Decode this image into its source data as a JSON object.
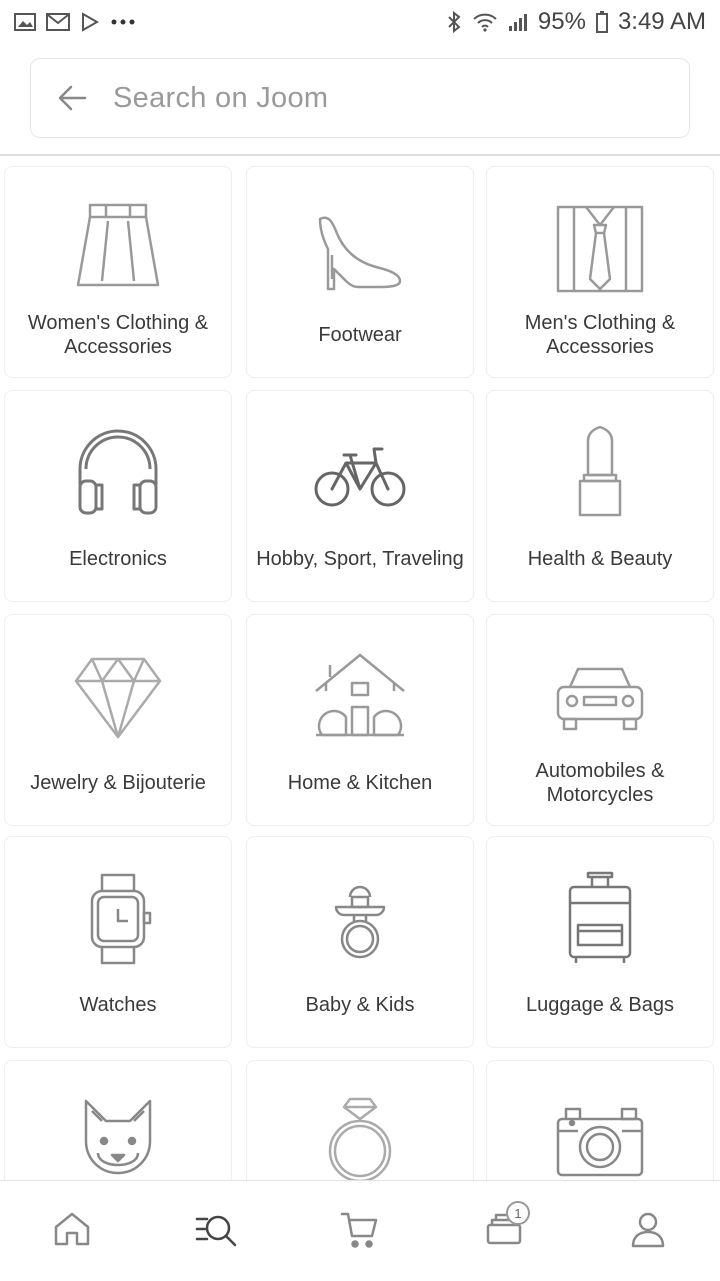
{
  "status_bar": {
    "battery": "95%",
    "time": "3:49 AM"
  },
  "search": {
    "placeholder": "Search on Joom"
  },
  "categories": [
    {
      "label": "Women's Clothing & Accessories",
      "icon": "skirt-icon"
    },
    {
      "label": "Footwear",
      "icon": "high-heel-icon"
    },
    {
      "label": "Men's Clothing & Accessories",
      "icon": "shirt-tie-icon"
    },
    {
      "label": "Electronics",
      "icon": "headphones-icon"
    },
    {
      "label": "Hobby, Sport, Traveling",
      "icon": "bicycle-icon"
    },
    {
      "label": "Health & Beauty",
      "icon": "lipstick-icon"
    },
    {
      "label": "Jewelry & Bijouterie",
      "icon": "diamond-icon"
    },
    {
      "label": "Home & Kitchen",
      "icon": "house-icon"
    },
    {
      "label": "Automobiles & Motorcycles",
      "icon": "car-icon"
    },
    {
      "label": "Watches",
      "icon": "wristwatch-icon"
    },
    {
      "label": "Baby & Kids",
      "icon": "pacifier-icon"
    },
    {
      "label": "Luggage & Bags",
      "icon": "suitcase-icon"
    },
    {
      "label": "",
      "icon": "dog-icon"
    },
    {
      "label": "",
      "icon": "ring-icon"
    },
    {
      "label": "",
      "icon": "camera-icon"
    }
  ],
  "bottom_nav": {
    "items": [
      "home-icon",
      "search-catalog-icon",
      "cart-icon",
      "orders-icon",
      "profile-icon"
    ],
    "orders_badge": "1"
  }
}
